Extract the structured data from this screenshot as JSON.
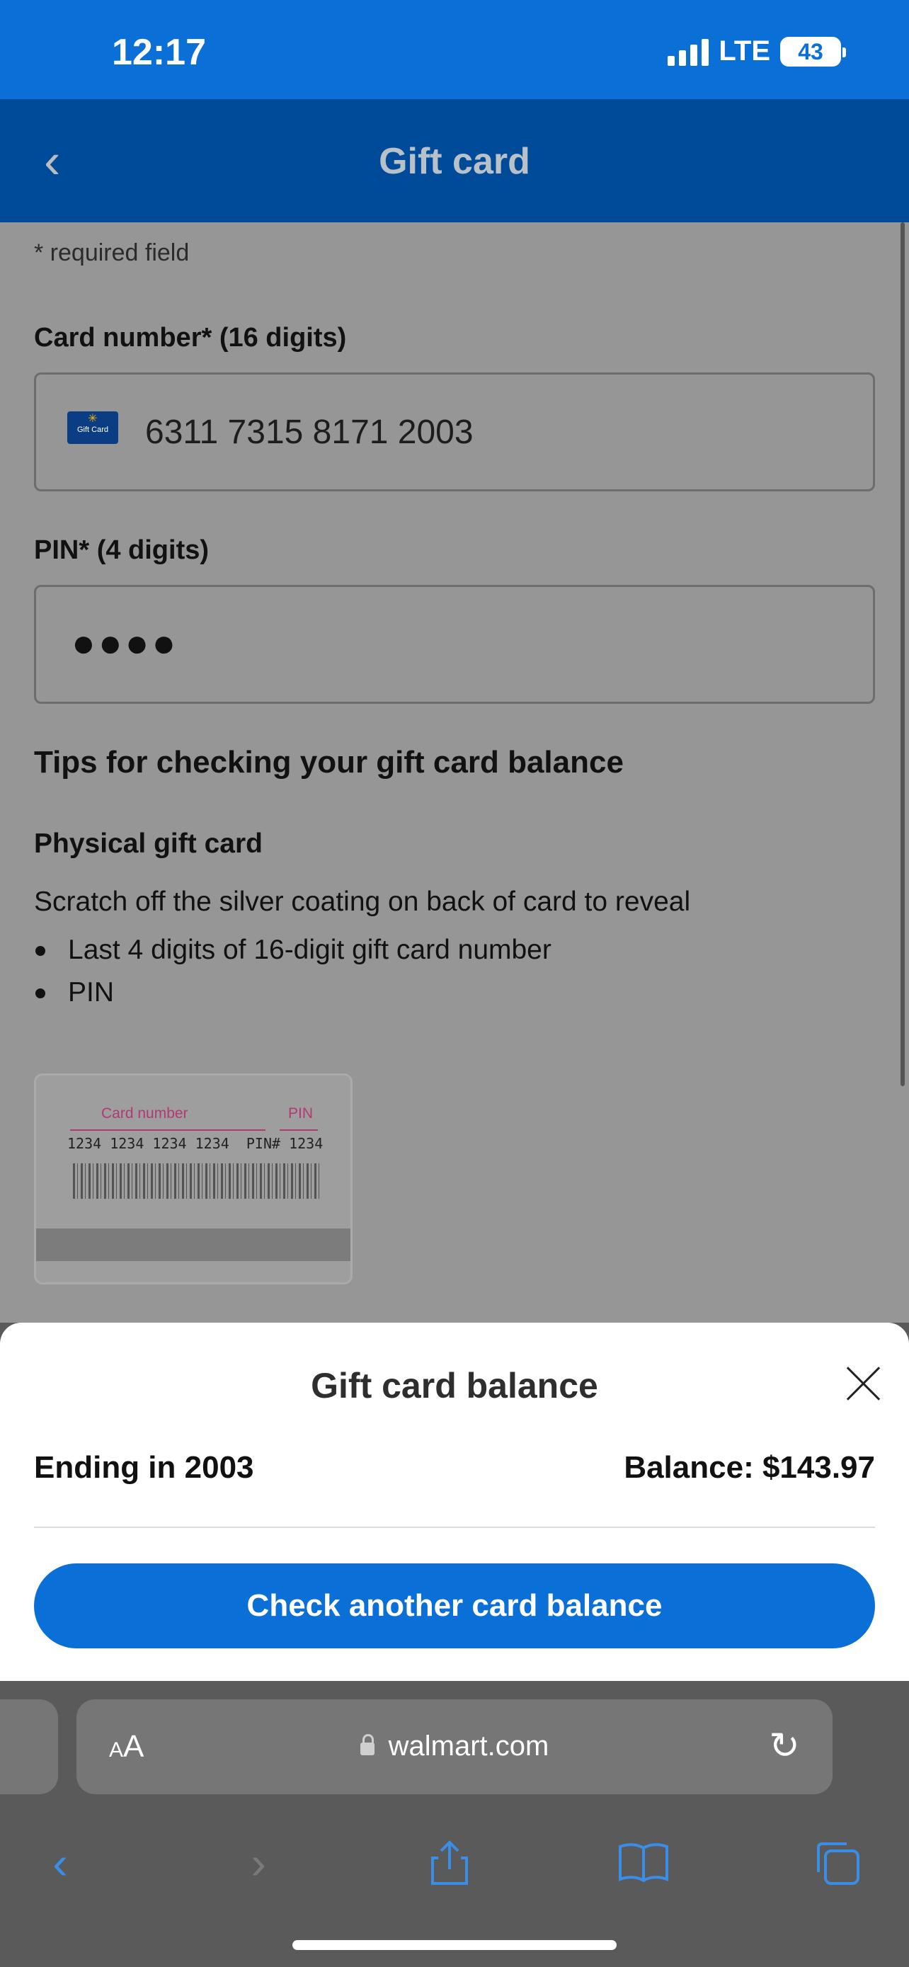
{
  "status_bar": {
    "time": "12:17",
    "network": "LTE",
    "battery": "43"
  },
  "nav": {
    "title": "Gift card",
    "back_icon": "chevron-left-icon"
  },
  "form": {
    "required_note": "* required field",
    "card_number_label": "Card number* (16 digits)",
    "card_number_value": "6311 7315 8171 2003",
    "card_icon_text": "Gift Card",
    "pin_label": "PIN* (4 digits)",
    "pin_value": "●●●●"
  },
  "tips": {
    "title": "Tips for checking your gift card balance",
    "physical_title": "Physical gift card",
    "body": "Scratch off the silver coating on back of card to reveal",
    "bullets": [
      "Last 4 digits of 16-digit gift card number",
      "PIN"
    ]
  },
  "card_image": {
    "card_number_label": "Card number",
    "pin_label": "PIN",
    "digits": "1234 1234 1234 1234  PIN# 1234"
  },
  "sheet": {
    "title": "Gift card balance",
    "ending": "Ending in 2003",
    "balance": "Balance: $143.97",
    "button": "Check another card balance"
  },
  "safari": {
    "aa_small": "A",
    "aa_large": "A",
    "url": "walmart.com"
  },
  "colors": {
    "brand_blue": "#0a6fd6",
    "nav_blue": "#004a9a"
  }
}
